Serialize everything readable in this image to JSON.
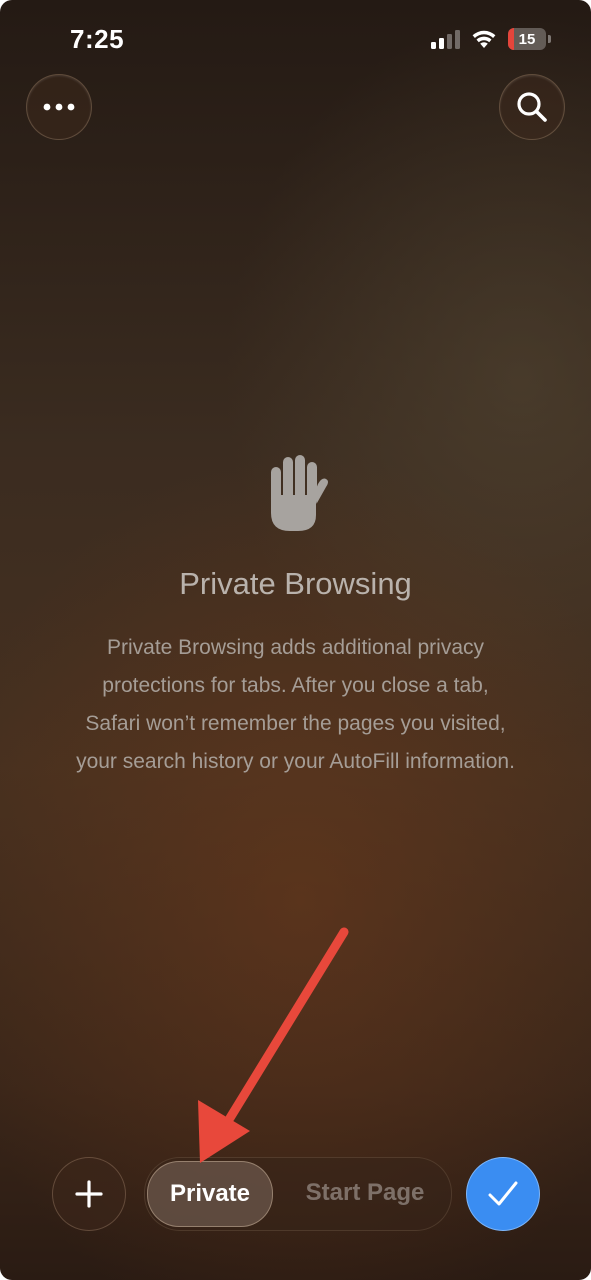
{
  "status_bar": {
    "time": "7:25",
    "battery_level": "15",
    "icons": [
      "cellular-signal-icon",
      "wifi-icon",
      "battery-icon"
    ]
  },
  "top_bar": {
    "left_button_icon": "ellipsis-icon",
    "right_button_icon": "search-icon"
  },
  "private_browsing": {
    "icon": "raised-hand-icon",
    "title": "Private Browsing",
    "description": "Private Browsing adds additional privacy protections for tabs. After you close a tab, Safari won’t remember the pages you visited, your search history or your AutoFill information.",
    "description_lines": [
      "Private Browsing adds additional privacy",
      "protections for tabs. After you close a tab,",
      "Safari won’t remember the pages you visited,",
      "your search history or your AutoFill information."
    ]
  },
  "bottom_toolbar": {
    "add_icon": "plus-icon",
    "tabs": [
      {
        "label": "Private",
        "selected": true
      },
      {
        "label": "Start Page",
        "selected": false
      }
    ],
    "done_icon": "checkmark-icon"
  },
  "annotation": {
    "arrow_icon": "red-arrow-icon",
    "color": "#e8483b"
  },
  "colors": {
    "accent_blue": "#3a8df2",
    "battery_low": "#e5453b"
  }
}
